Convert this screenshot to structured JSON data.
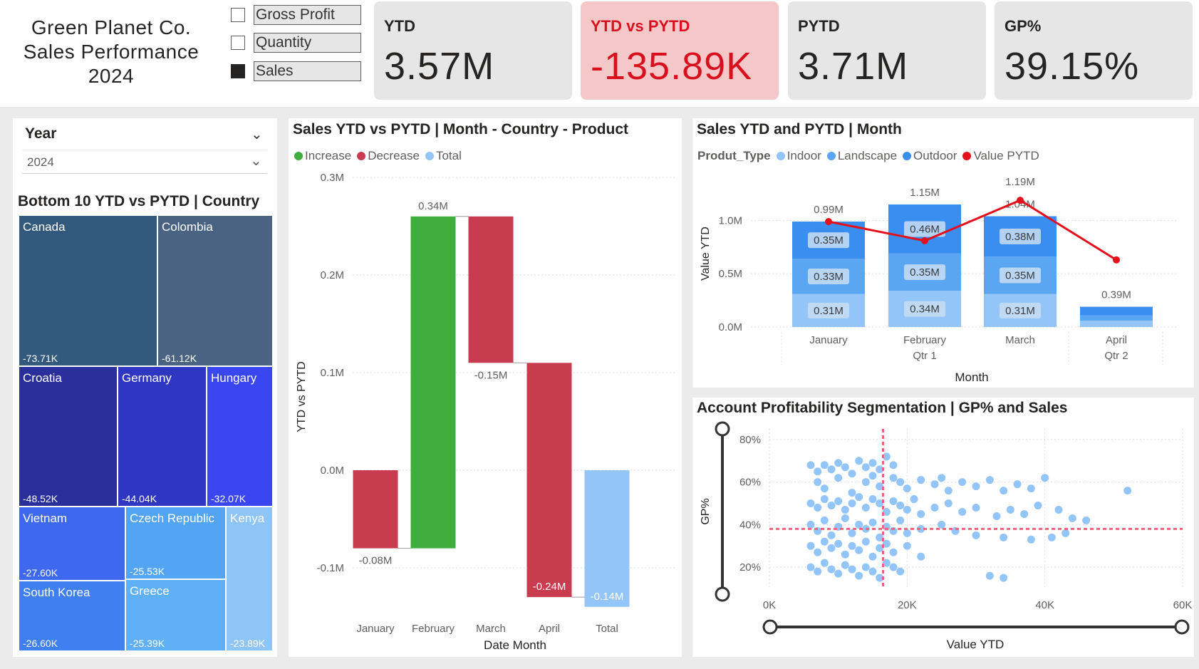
{
  "report": {
    "title_lines": [
      "Green Planet Co.",
      "Sales Performance",
      "2024"
    ]
  },
  "measure_toggle": {
    "options": [
      {
        "label": "Gross Profit",
        "checked": false
      },
      {
        "label": "Quantity",
        "checked": false
      },
      {
        "label": "Sales",
        "checked": true
      }
    ]
  },
  "kpis": [
    {
      "label": "YTD",
      "value": "3.57M",
      "highlight": false
    },
    {
      "label": "YTD vs PYTD",
      "value": "-135.89K",
      "highlight": true,
      "color": "#d8101e"
    },
    {
      "label": "PYTD",
      "value": "3.71M",
      "highlight": false
    },
    {
      "label": "GP%",
      "value": "39.15%",
      "highlight": false
    }
  ],
  "year_slicer": {
    "label": "Year",
    "value": "2024"
  },
  "treemap": {
    "title": "Bottom 10 YTD vs PYTD | Country",
    "items": [
      {
        "name": "Canada",
        "value": "-73.71K",
        "color": "#335a7c"
      },
      {
        "name": "Colombia",
        "value": "-61.12K",
        "color": "#4a6382"
      },
      {
        "name": "Croatia",
        "value": "-48.52K",
        "color": "#2a2f9b"
      },
      {
        "name": "Germany",
        "value": "-44.04K",
        "color": "#2f36c2"
      },
      {
        "name": "Hungary",
        "value": "-32.07K",
        "color": "#3a46f0"
      },
      {
        "name": "Vietnam",
        "value": "-27.60K",
        "color": "#3e68ee"
      },
      {
        "name": "South Korea",
        "value": "-26.60K",
        "color": "#3f7ff0"
      },
      {
        "name": "Czech Republic",
        "value": "-25.53K",
        "color": "#53a5f4"
      },
      {
        "name": "Greece",
        "value": "-25.39K",
        "color": "#5fb0f6"
      },
      {
        "name": "Kenya",
        "value": "-23.89K",
        "color": "#8fc4f7"
      }
    ]
  },
  "waterfall": {
    "title": "Sales YTD vs PYTD | Month - Country - Product",
    "legend": [
      {
        "label": "Increase",
        "color": "#3fae3c"
      },
      {
        "label": "Decrease",
        "color": "#c93c50"
      },
      {
        "label": "Total",
        "color": "#93c5f8"
      }
    ],
    "xlabel": "Date Month",
    "ylabel": "YTD vs PYTD"
  },
  "combo": {
    "title": "Sales YTD and PYTD | Month",
    "legend_title": "Produt_Type",
    "legend": [
      {
        "label": "Indoor",
        "color": "#93c5f8"
      },
      {
        "label": "Landscape",
        "color": "#5aa6f2"
      },
      {
        "label": "Outdoor",
        "color": "#3a8ef0"
      },
      {
        "label": "Value PYTD",
        "color": "#e4101c"
      }
    ],
    "xlabel": "Month",
    "ylabel": "Value YTD"
  },
  "scatter": {
    "title": "Account Profitability Segmentation | GP% and Sales",
    "xlabel": "Value YTD",
    "ylabel": "GP%"
  },
  "chart_data": [
    {
      "type": "bar",
      "subtype": "waterfall",
      "categories": [
        "January",
        "February",
        "March",
        "April",
        "Total"
      ],
      "values": [
        -0.08,
        0.34,
        -0.15,
        -0.24,
        -0.14
      ],
      "labels": [
        "-0.08M",
        "0.34M",
        "-0.15M",
        "-0.24M",
        "-0.14M"
      ],
      "kinds": [
        "decrease",
        "increase",
        "decrease",
        "decrease",
        "total"
      ],
      "y_ticks": [
        "0.3M",
        "0.2M",
        "0.1M",
        "0.0M",
        "-0.1M"
      ],
      "ylim": [
        -0.14,
        0.3
      ],
      "xlabel": "Date Month",
      "ylabel": "YTD vs PYTD"
    },
    {
      "type": "bar",
      "subtype": "stacked+line",
      "categories": [
        "January",
        "February",
        "March",
        "April"
      ],
      "cat_sub": [
        "",
        "Qtr 1",
        "",
        "Qtr 2"
      ],
      "series": [
        {
          "name": "Indoor",
          "values": [
            0.31,
            0.34,
            0.31,
            0.06
          ],
          "labels": [
            "0.31M",
            "0.34M",
            "0.31M",
            ""
          ]
        },
        {
          "name": "Landscape",
          "values": [
            0.33,
            0.35,
            0.35,
            0.05
          ],
          "labels": [
            "0.33M",
            "0.35M",
            "0.35M",
            ""
          ]
        },
        {
          "name": "Outdoor",
          "values": [
            0.35,
            0.46,
            0.38,
            0.08
          ],
          "labels": [
            "0.35M",
            "0.46M",
            "0.38M",
            ""
          ]
        },
        {
          "name": "Value PYTD",
          "type": "line",
          "values": [
            0.99,
            0.81,
            1.19,
            0.63
          ],
          "labels": [
            "",
            "",
            "1.19M",
            ""
          ]
        }
      ],
      "totals": [
        "0.99M",
        "1.15M",
        "1.04M",
        "0.39M"
      ],
      "y_ticks": [
        "1.0M",
        "0.5M",
        "0.0M"
      ],
      "ylim": [
        0,
        1.3
      ],
      "xlabel": "Month",
      "ylabel": "Value YTD"
    },
    {
      "type": "scatter",
      "xlabel": "Value YTD",
      "ylabel": "GP%",
      "x_ticks": [
        "0K",
        "20K",
        "40K",
        "60K"
      ],
      "y_ticks": [
        "80%",
        "60%",
        "40%",
        "20%"
      ],
      "xlim": [
        0,
        60000
      ],
      "ylim": [
        10,
        85
      ],
      "ref_x": 16500,
      "ref_y": 38,
      "point_color": "#93c5f8",
      "points": [
        [
          6,
          68
        ],
        [
          7,
          65
        ],
        [
          8,
          68
        ],
        [
          9,
          66
        ],
        [
          10,
          69
        ],
        [
          11,
          67
        ],
        [
          12,
          64
        ],
        [
          13,
          70
        ],
        [
          14,
          67
        ],
        [
          15,
          69
        ],
        [
          16,
          66
        ],
        [
          17,
          72
        ],
        [
          18,
          68
        ],
        [
          7,
          60
        ],
        [
          8,
          57
        ],
        [
          10,
          62
        ],
        [
          12,
          55
        ],
        [
          14,
          60
        ],
        [
          15,
          63
        ],
        [
          16,
          58
        ],
        [
          18,
          62
        ],
        [
          19,
          60
        ],
        [
          20,
          57
        ],
        [
          22,
          61
        ],
        [
          24,
          59
        ],
        [
          25,
          62
        ],
        [
          26,
          56
        ],
        [
          28,
          60
        ],
        [
          30,
          58
        ],
        [
          32,
          61
        ],
        [
          34,
          56
        ],
        [
          36,
          59
        ],
        [
          38,
          57
        ],
        [
          40,
          62
        ],
        [
          6,
          50
        ],
        [
          7,
          48
        ],
        [
          8,
          52
        ],
        [
          9,
          49
        ],
        [
          10,
          51
        ],
        [
          11,
          47
        ],
        [
          12,
          50
        ],
        [
          13,
          53
        ],
        [
          14,
          48
        ],
        [
          15,
          52
        ],
        [
          16,
          50
        ],
        [
          17,
          46
        ],
        [
          18,
          51
        ],
        [
          19,
          49
        ],
        [
          20,
          47
        ],
        [
          21,
          52
        ],
        [
          22,
          45
        ],
        [
          24,
          48
        ],
        [
          26,
          50
        ],
        [
          28,
          46
        ],
        [
          30,
          48
        ],
        [
          33,
          44
        ],
        [
          35,
          47
        ],
        [
          37,
          45
        ],
        [
          39,
          49
        ],
        [
          42,
          47
        ],
        [
          44,
          43
        ],
        [
          46,
          42
        ],
        [
          52,
          56
        ],
        [
          6,
          40
        ],
        [
          7,
          37
        ],
        [
          8,
          42
        ],
        [
          9,
          35
        ],
        [
          10,
          39
        ],
        [
          11,
          43
        ],
        [
          12,
          36
        ],
        [
          13,
          40
        ],
        [
          14,
          38
        ],
        [
          15,
          41
        ],
        [
          16,
          34
        ],
        [
          17,
          39
        ],
        [
          18,
          37
        ],
        [
          19,
          42
        ],
        [
          20,
          36
        ],
        [
          22,
          38
        ],
        [
          25,
          40
        ],
        [
          27,
          37
        ],
        [
          30,
          35
        ],
        [
          34,
          34
        ],
        [
          38,
          33
        ],
        [
          41,
          34
        ],
        [
          43,
          36
        ],
        [
          6,
          30
        ],
        [
          7,
          27
        ],
        [
          8,
          32
        ],
        [
          9,
          29
        ],
        [
          10,
          31
        ],
        [
          11,
          26
        ],
        [
          12,
          30
        ],
        [
          13,
          28
        ],
        [
          14,
          32
        ],
        [
          15,
          25
        ],
        [
          16,
          29
        ],
        [
          17,
          31
        ],
        [
          18,
          27
        ],
        [
          20,
          30
        ],
        [
          22,
          25
        ],
        [
          6,
          20
        ],
        [
          7,
          18
        ],
        [
          8,
          22
        ],
        [
          9,
          19
        ],
        [
          10,
          17
        ],
        [
          11,
          21
        ],
        [
          12,
          19
        ],
        [
          13,
          16
        ],
        [
          14,
          20
        ],
        [
          15,
          18
        ],
        [
          16,
          15
        ],
        [
          17,
          22
        ],
        [
          18,
          20
        ],
        [
          19,
          18
        ],
        [
          32,
          16
        ],
        [
          34,
          15
        ]
      ]
    }
  ]
}
